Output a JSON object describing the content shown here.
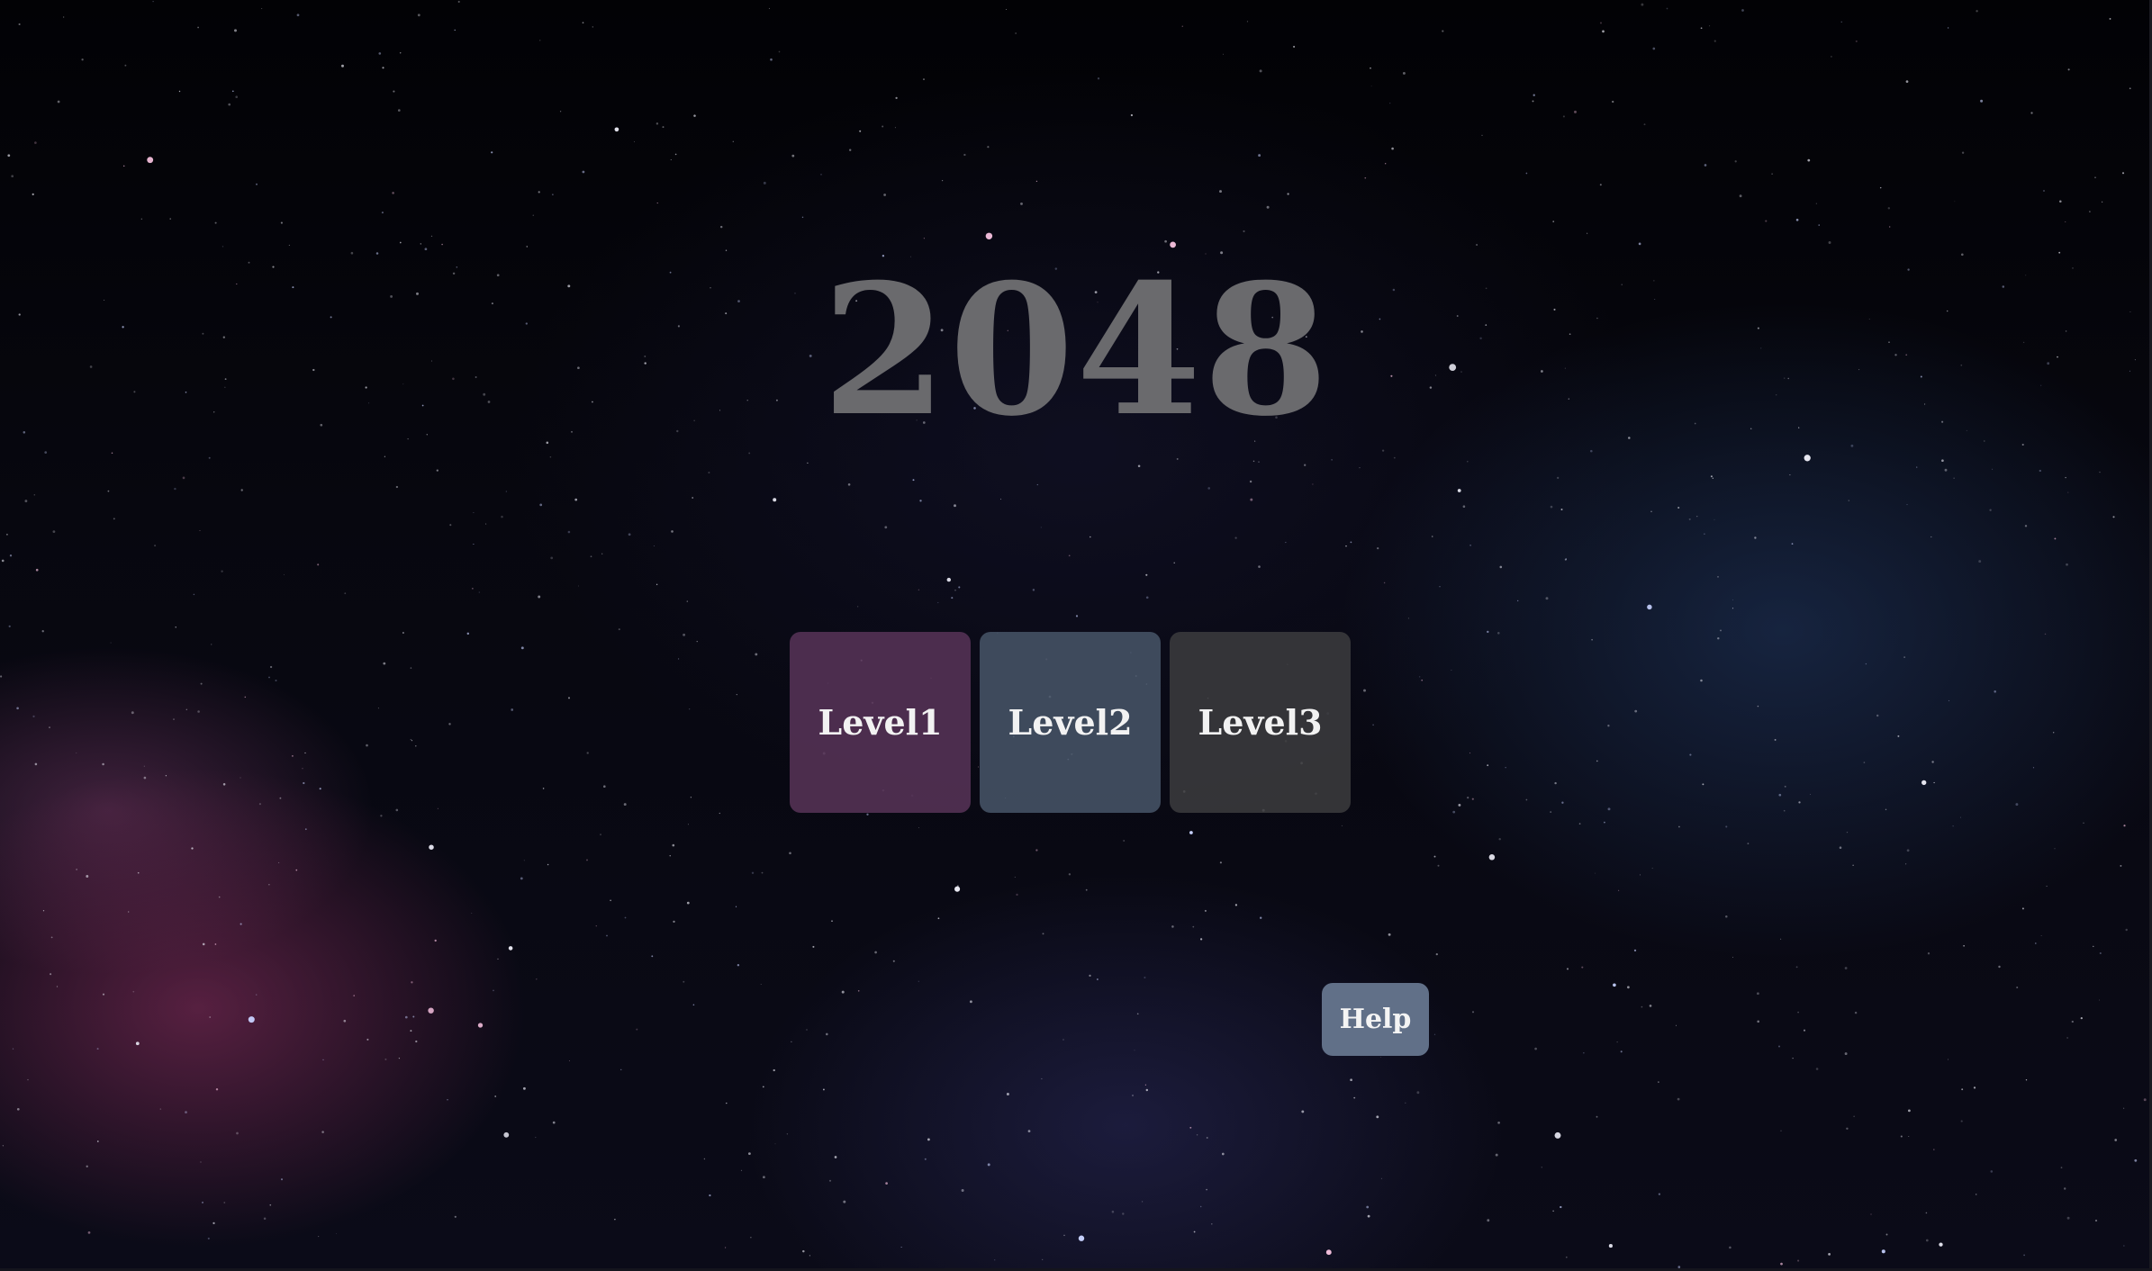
{
  "game": {
    "title": "2048",
    "levels": [
      {
        "label": "Level1",
        "color": "#583458"
      },
      {
        "label": "Level2",
        "color": "#485668"
      },
      {
        "label": "Level3",
        "color": "#3c3c3e"
      }
    ],
    "help_label": "Help",
    "help_color": "#617088",
    "title_color": "#6a6a6d"
  }
}
